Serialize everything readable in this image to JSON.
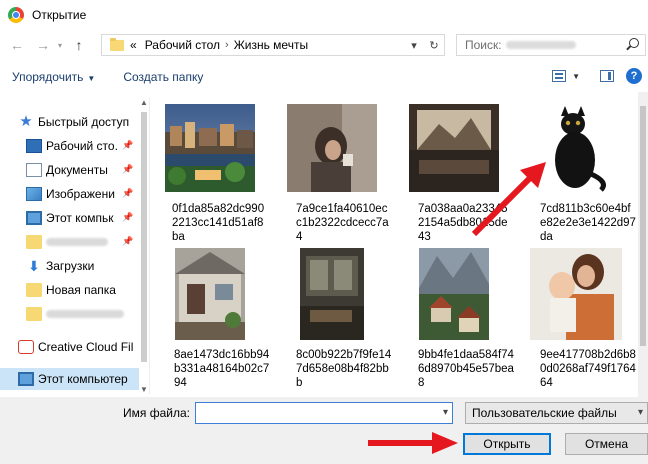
{
  "window": {
    "title": "Открытие",
    "icon": "chrome-icon"
  },
  "nav": {
    "back_icon": "arrow-left-icon",
    "forward_icon": "arrow-right-icon",
    "recent_icon": "chevron-down-icon",
    "up_icon": "arrow-up-icon",
    "breadcrumbs": [
      "«",
      "Рабочий стол",
      "Жизнь мечты"
    ],
    "search_placeholder": "Поиск:"
  },
  "toolbar": {
    "organize_label": "Упорядочить",
    "new_folder_label": "Создать папку"
  },
  "sidebar": {
    "items": [
      {
        "label": "Быстрый доступ",
        "icon": "star-icon"
      },
      {
        "label": "Рабочий сто.",
        "icon": "desktop-icon",
        "pinned": true
      },
      {
        "label": "Документы",
        "icon": "documents-icon",
        "pinned": true
      },
      {
        "label": "Изображени",
        "icon": "pictures-icon",
        "pinned": true
      },
      {
        "label": "Этот компьк",
        "icon": "computer-icon",
        "pinned": true
      },
      {
        "label": "",
        "icon": "folder-icon",
        "pinned": true
      },
      {
        "label": "Загрузки",
        "icon": "download-icon"
      },
      {
        "label": "Новая папка",
        "icon": "folder-icon"
      },
      {
        "label": "",
        "icon": "folder-icon"
      },
      {
        "label": "Creative Cloud Fil",
        "icon": "creative-cloud-icon"
      },
      {
        "label": "Этот компьютер",
        "icon": "computer-icon",
        "selected": true
      }
    ]
  },
  "files": [
    {
      "name": "0f1da85a82dc9902213cc141d51af8ba",
      "icon": "city-photo"
    },
    {
      "name": "7a9ce1fa40610ecc1b2322cdcecc7a4",
      "icon": "woman-coffee-photo"
    },
    {
      "name": "7a038aa0a23345... 2154a5db8015... de43",
      "name_lines": [
        "7a038aa0a23345",
        "2154a5db8015",
        "43"
      ],
      "icon": "mountain-cabin-photo"
    },
    {
      "name": "7cd811b3c60e4bfe82e2e3e1422d97da",
      "icon": "black-cat-photo"
    },
    {
      "name": "8ae1473dc16bb94b331a48164b02c794",
      "icon": "house-porch-photo"
    },
    {
      "name": "8c00b922b7f9fe147d658e08b4f82bbb",
      "icon": "interior-room-photo"
    },
    {
      "name": "9bb4fe1daa584f746d8970b45e57bea8",
      "icon": "alpine-village-photo"
    },
    {
      "name": "9ee417708b2d6b80d0268af749f176464",
      "icon": "mother-child-photo"
    }
  ],
  "bottom": {
    "filename_label": "Имя файла:",
    "filename_value": "",
    "filetype_value": "Пользовательские файлы",
    "open_label": "Открыть",
    "cancel_label": "Отмена"
  },
  "annotation_color": "#e5181f"
}
